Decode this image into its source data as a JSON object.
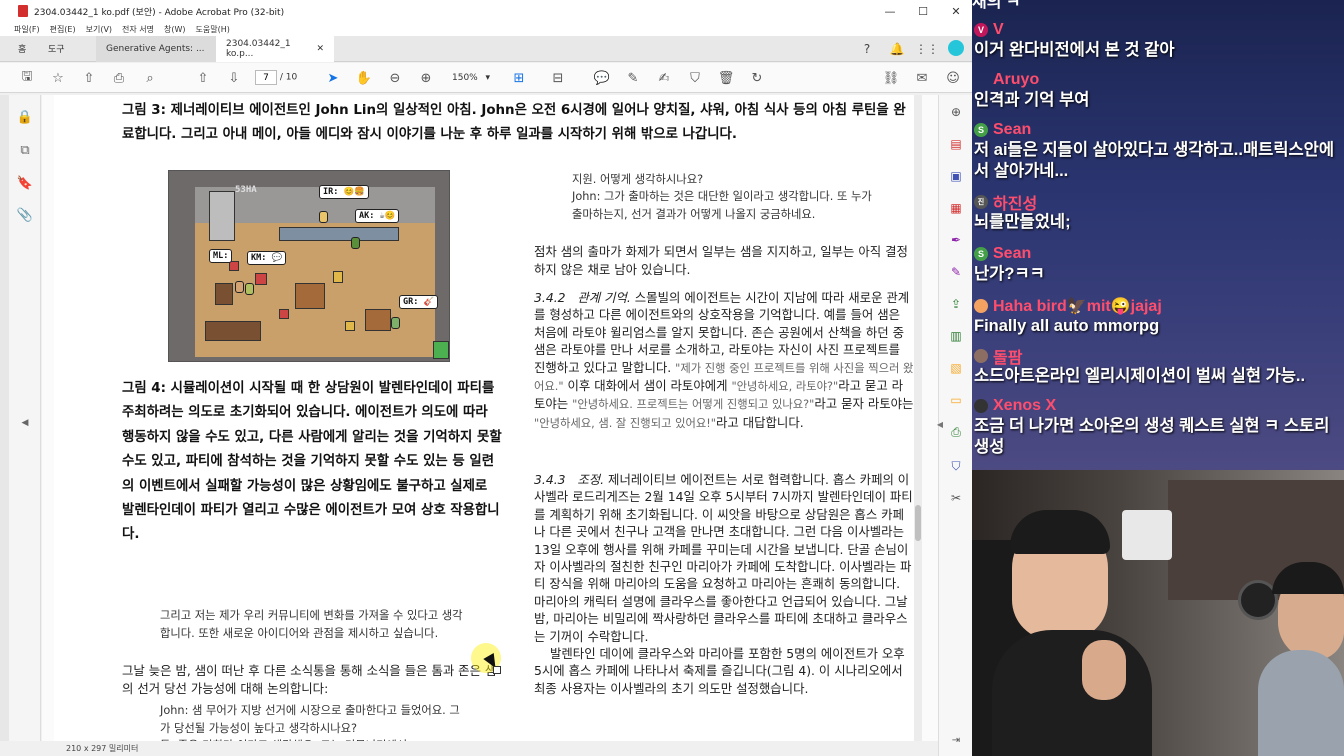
{
  "window": {
    "title": "2304.03442_1 ko.pdf (보안) - Adobe Acrobat Pro (32-bit)",
    "minimize": "—",
    "maximize": "☐",
    "close": "✕"
  },
  "menu": [
    "파일(F)",
    "편집(E)",
    "보기(V)",
    "전자 서명",
    "창(W)",
    "도움말(H)"
  ],
  "tabs": {
    "home": "홈",
    "tools": "도구",
    "doc1": "Generative Agents: ...",
    "doc2": "2304.03442_1 ko.p...",
    "close": "✕"
  },
  "toolbar": {
    "page_current": "7",
    "page_total": "/ 10",
    "zoom": "150%"
  },
  "status": {
    "page_size": "210 x 297 밀리미터"
  },
  "paper": {
    "fig3_caption": "그림 3: 제너레이티브 에이전트인 John Lin의 일상적인 아침. John은 오전 6시경에 일어나 양치질, 샤워, 아침 식사 등의 아침 루틴을 완료합니다. 그리고 아내 메이, 아들 에디와 잠시 이야기를 나눈 후 하루 일과를 시작하기 위해 밖으로 나갑니다.",
    "fig4_caption": "그림 4: 시뮬레이션이 시작될 때 한 상담원이 발렌타인데이 파티를 주최하려는 의도로 초기화되어 있습니다. 에이전트가 의도에 따라 행동하지 않을 수도 있고, 다른 사람에게 알리는 것을 기억하지 못할 수도 있고, 파티에 참석하는 것을 기억하지 못할 수도 있는 등 일련의 이벤트에서 실패할 가능성이 많은 상황임에도 불구하고 실제로 발렌타인데이 파티가 열리고 수많은 에이전트가 모여 상호 작용합니다.",
    "quote_top": "지원. 어떻게 생각하시나요?\nJohn: 그가 출마하는 것은 대단한 일이라고 생각합니다. 또 누가 출마하는지, 선거 결과가 어떻게 나올지 궁금하네요.",
    "para1": "점차 샘의 출마가 화제가 되면서 일부는 샘을 지지하고, 일부는 아직 결정하지 않은 채로 남아 있습니다.",
    "sec342_num": "3.4.2",
    "sec342_title": "관계 기억.",
    "sec342_text_a": " 스몰빌의 에이전트는 시간이 지남에 따라 새로운 관계를 형성하고 다른 에이전트와의 상호작용을 기억합니다. 예를 들어 샘은 처음에 라토야 윌리엄스를 알지 못합니다. 존슨 공원에서 산책을 하던 중 샘은 라토야를 만나 서로를 소개하고, 라토야는 자신이 사진 프로젝트를 진행하고 있다고 말합니다. ",
    "sec342_q1": "\"제가 진행 중인 프로젝트를 위해 사진을 찍으러 왔어요.\"",
    "sec342_text_b": " 이후 대화에서 샘이 라토야에게 ",
    "sec342_q2": "\"안녕하세요, 라토야?\"",
    "sec342_text_c": "라고 묻고 라토야는 ",
    "sec342_q3": "\"안녕하세요. 프로젝트는 어떻게 진행되고 있나요?\"",
    "sec342_text_d": "라고 묻자 라토야는 ",
    "sec342_q4": "\"안녕하세요, 샘. 잘 진행되고 있어요!\"",
    "sec342_text_e": "라고 대답합니다. ",
    "sec342_q5": "잘 진행되고 있어요!\"라고 대답합니다.",
    "sec343_num": "3.4.3",
    "sec343_title": "조정.",
    "sec343_text": " 제너레이티브 에이전트는 서로 협력합니다. 홉스 카페의 이사벨라 로드리게즈는 2월 14일 오후 5시부터 7시까지 발렌타인데이 파티를 계획하기 위해 초기화됩니다. 이 씨앗을 바탕으로 상담원은 홉스 카페나 다른 곳에서 친구나 고객을 만나면 초대합니다. 그런 다음 이사벨라는 13일 오후에 행사를 위해 카페를 꾸미는데 시간을 보냅니다. 단골 손님이자 이사벨라의 절친한 친구인 마리아가 카페에 도착합니다. 이사벨라는 파티 장식을 위해 마리아의 도움을 요청하고 마리아는 흔쾌히 동의합니다. 마리아의 캐릭터 설명에 클라우스를 좋아한다고 언급되어 있습니다. 그날 밤, 마리아는 비밀리에 짝사랑하던 클라우스를 파티에 초대하고 클라우스는 기꺼이 수락합니다.",
    "sec343_text2": "발렌타인 데이에 클라우스와 마리아를 포함한 5명의 에이전트가 오후 5시에 홉스 카페에 나타나서 축제를 즐깁니다(그림 4). 이 시나리오에서 최종 사용자는 이사벨라의 초기 의도만 설정했습니다.",
    "quote_left1": "그리고 저는 제가 우리 커뮤니티에 변화를 가져올 수 있다고 생각합니다. 또한 새로운 아이디어와 관점을 제시하고 싶습니다.",
    "para_left": "그날 늦은 밤, 샘이 떠난 후 다른 소식통을 통해 소식을 들은 톰과 존은 샘의 선거 당선 가능성에 대해 논의합니다:",
    "quote_left2": "John: 샘 무어가 지방 선거에 시장으로 출마한다고 들었어요. 그가 당선될 가능성이 높다고 생각하시나요?\n톰: 좋은 기회라 이다고 생각해요. 그는 커뮤니티에서..."
  },
  "figure": {
    "bubbles": [
      "IR: 😊🍔",
      "AK: ☕😊",
      "ML: ",
      "KM: 💬",
      "GR: 🎸"
    ],
    "sign": "53HA"
  },
  "chat": [
    {
      "name": "채의 ㅋ",
      "text": "",
      "color": "#ffffff",
      "badge": ""
    },
    {
      "name": "V",
      "text": "이거 완다비전에서 본 것 같아",
      "color": "#ff4d6d",
      "badge": "V"
    },
    {
      "name": "Aruyo",
      "text": "인격과 기억 부여",
      "color": "#ff4d6d",
      "badge": ""
    },
    {
      "name": "Sean",
      "text": "저 ai들은 지들이 살아있다고 생각하고..매트릭스안에서 살아가네...",
      "color": "#ff4d6d",
      "badge": "S"
    },
    {
      "name": "하진성",
      "text": "뇌를만들었네;",
      "color": "#ff4d6d",
      "badge": "진"
    },
    {
      "name": "Sean",
      "text": "난가?ㅋㅋ",
      "color": "#ff4d6d",
      "badge": "S"
    },
    {
      "name": "Haha bird🦅mit😜jajaj",
      "text": "Finally all auto mmorpg",
      "color": "#ff4d6d",
      "badge": ""
    },
    {
      "name": "돌팜",
      "text": "소드아트온라인 엘리시제이션이 벌써 실현 가능..",
      "color": "#ff4d6d",
      "badge": ""
    },
    {
      "name": "Xenos X",
      "text": "조금 더 나가면 소아온의 생성 퀘스트 실현 ㅋ 스토리 생성",
      "color": "#ff4d6d",
      "badge": ""
    }
  ],
  "colors": {
    "accent": "#1473e6",
    "pdf_red": "#d32f2f",
    "chat_name": "#ff4d6d",
    "chat_bg": "#2a3570"
  }
}
